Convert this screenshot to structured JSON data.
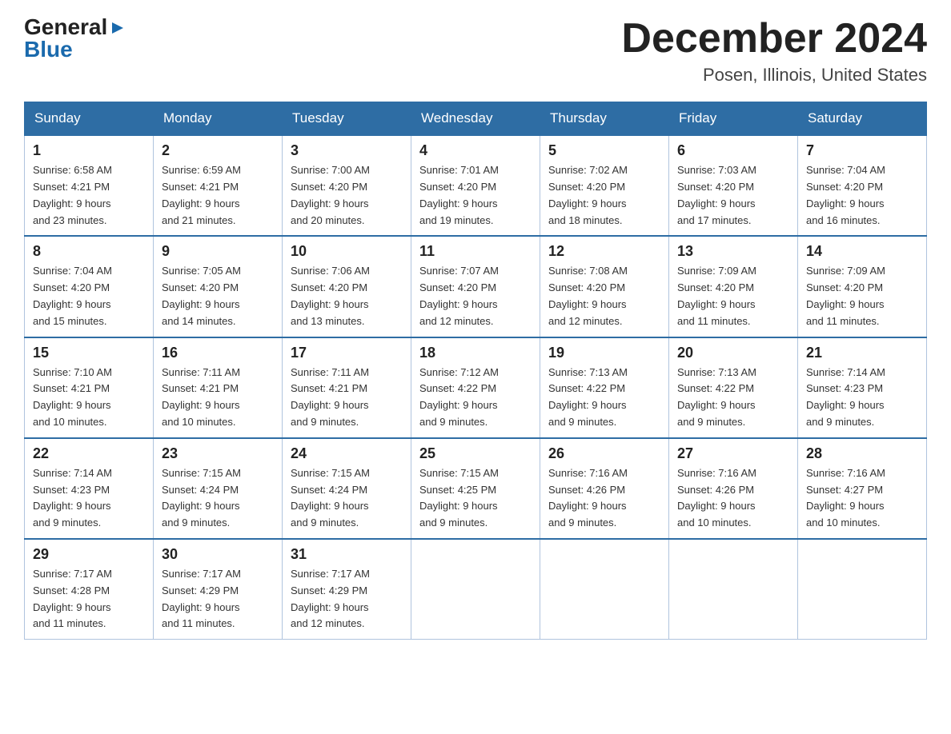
{
  "logo": {
    "general": "General",
    "blue": "Blue",
    "arrow": "▶"
  },
  "title": {
    "month_year": "December 2024",
    "location": "Posen, Illinois, United States"
  },
  "days_of_week": [
    "Sunday",
    "Monday",
    "Tuesday",
    "Wednesday",
    "Thursday",
    "Friday",
    "Saturday"
  ],
  "weeks": [
    [
      {
        "day": "1",
        "sunrise": "6:58 AM",
        "sunset": "4:21 PM",
        "daylight": "9 hours and 23 minutes."
      },
      {
        "day": "2",
        "sunrise": "6:59 AM",
        "sunset": "4:21 PM",
        "daylight": "9 hours and 21 minutes."
      },
      {
        "day": "3",
        "sunrise": "7:00 AM",
        "sunset": "4:20 PM",
        "daylight": "9 hours and 20 minutes."
      },
      {
        "day": "4",
        "sunrise": "7:01 AM",
        "sunset": "4:20 PM",
        "daylight": "9 hours and 19 minutes."
      },
      {
        "day": "5",
        "sunrise": "7:02 AM",
        "sunset": "4:20 PM",
        "daylight": "9 hours and 18 minutes."
      },
      {
        "day": "6",
        "sunrise": "7:03 AM",
        "sunset": "4:20 PM",
        "daylight": "9 hours and 17 minutes."
      },
      {
        "day": "7",
        "sunrise": "7:04 AM",
        "sunset": "4:20 PM",
        "daylight": "9 hours and 16 minutes."
      }
    ],
    [
      {
        "day": "8",
        "sunrise": "7:04 AM",
        "sunset": "4:20 PM",
        "daylight": "9 hours and 15 minutes."
      },
      {
        "day": "9",
        "sunrise": "7:05 AM",
        "sunset": "4:20 PM",
        "daylight": "9 hours and 14 minutes."
      },
      {
        "day": "10",
        "sunrise": "7:06 AM",
        "sunset": "4:20 PM",
        "daylight": "9 hours and 13 minutes."
      },
      {
        "day": "11",
        "sunrise": "7:07 AM",
        "sunset": "4:20 PM",
        "daylight": "9 hours and 12 minutes."
      },
      {
        "day": "12",
        "sunrise": "7:08 AM",
        "sunset": "4:20 PM",
        "daylight": "9 hours and 12 minutes."
      },
      {
        "day": "13",
        "sunrise": "7:09 AM",
        "sunset": "4:20 PM",
        "daylight": "9 hours and 11 minutes."
      },
      {
        "day": "14",
        "sunrise": "7:09 AM",
        "sunset": "4:20 PM",
        "daylight": "9 hours and 11 minutes."
      }
    ],
    [
      {
        "day": "15",
        "sunrise": "7:10 AM",
        "sunset": "4:21 PM",
        "daylight": "9 hours and 10 minutes."
      },
      {
        "day": "16",
        "sunrise": "7:11 AM",
        "sunset": "4:21 PM",
        "daylight": "9 hours and 10 minutes."
      },
      {
        "day": "17",
        "sunrise": "7:11 AM",
        "sunset": "4:21 PM",
        "daylight": "9 hours and 9 minutes."
      },
      {
        "day": "18",
        "sunrise": "7:12 AM",
        "sunset": "4:22 PM",
        "daylight": "9 hours and 9 minutes."
      },
      {
        "day": "19",
        "sunrise": "7:13 AM",
        "sunset": "4:22 PM",
        "daylight": "9 hours and 9 minutes."
      },
      {
        "day": "20",
        "sunrise": "7:13 AM",
        "sunset": "4:22 PM",
        "daylight": "9 hours and 9 minutes."
      },
      {
        "day": "21",
        "sunrise": "7:14 AM",
        "sunset": "4:23 PM",
        "daylight": "9 hours and 9 minutes."
      }
    ],
    [
      {
        "day": "22",
        "sunrise": "7:14 AM",
        "sunset": "4:23 PM",
        "daylight": "9 hours and 9 minutes."
      },
      {
        "day": "23",
        "sunrise": "7:15 AM",
        "sunset": "4:24 PM",
        "daylight": "9 hours and 9 minutes."
      },
      {
        "day": "24",
        "sunrise": "7:15 AM",
        "sunset": "4:24 PM",
        "daylight": "9 hours and 9 minutes."
      },
      {
        "day": "25",
        "sunrise": "7:15 AM",
        "sunset": "4:25 PM",
        "daylight": "9 hours and 9 minutes."
      },
      {
        "day": "26",
        "sunrise": "7:16 AM",
        "sunset": "4:26 PM",
        "daylight": "9 hours and 9 minutes."
      },
      {
        "day": "27",
        "sunrise": "7:16 AM",
        "sunset": "4:26 PM",
        "daylight": "9 hours and 10 minutes."
      },
      {
        "day": "28",
        "sunrise": "7:16 AM",
        "sunset": "4:27 PM",
        "daylight": "9 hours and 10 minutes."
      }
    ],
    [
      {
        "day": "29",
        "sunrise": "7:17 AM",
        "sunset": "4:28 PM",
        "daylight": "9 hours and 11 minutes."
      },
      {
        "day": "30",
        "sunrise": "7:17 AM",
        "sunset": "4:29 PM",
        "daylight": "9 hours and 11 minutes."
      },
      {
        "day": "31",
        "sunrise": "7:17 AM",
        "sunset": "4:29 PM",
        "daylight": "9 hours and 12 minutes."
      },
      null,
      null,
      null,
      null
    ]
  ],
  "labels": {
    "sunrise": "Sunrise:",
    "sunset": "Sunset:",
    "daylight": "Daylight:"
  }
}
